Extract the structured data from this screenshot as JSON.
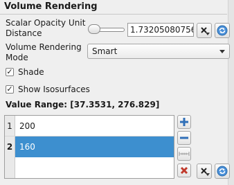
{
  "section": {
    "title": "Volume Rendering"
  },
  "scalar_opacity": {
    "label_line1": "Scalar Opacity Unit",
    "label_line2": "Distance",
    "value": "1.73205080756"
  },
  "rendering_mode": {
    "label_line1": "Volume Rendering",
    "label_line2": "Mode",
    "selected": "Smart"
  },
  "shade": {
    "label": "Shade",
    "checked": true,
    "mark": "✓"
  },
  "show_isosurfaces": {
    "label": "Show Isosurfaces",
    "checked": true,
    "mark": "✓"
  },
  "value_range": {
    "label": "Value Range:",
    "value": "[37.3531, 276.829]"
  },
  "isosurfaces": {
    "rows": [
      {
        "index": "1",
        "value": "200",
        "selected": false
      },
      {
        "index": "2",
        "value": "160",
        "selected": true
      }
    ]
  },
  "colors": {
    "selection": "#3d8fcf",
    "add": "#2f6fb8",
    "delete": "#c0392b"
  }
}
